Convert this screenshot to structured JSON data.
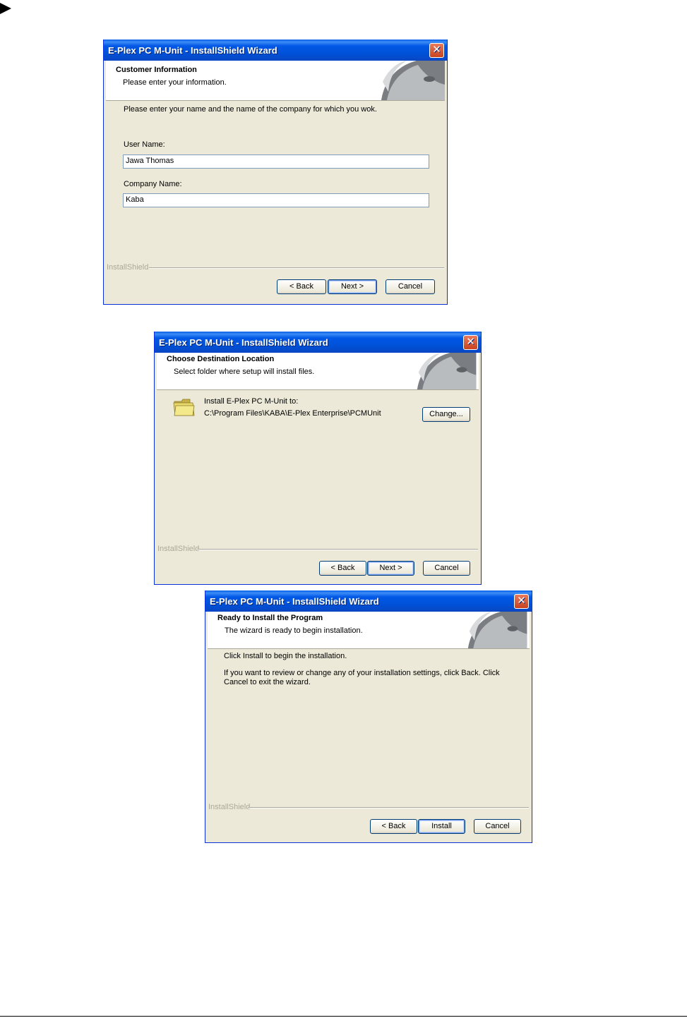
{
  "dialogs": [
    {
      "title": "E-Plex PC M-Unit - InstallShield Wizard",
      "close_label": "✕",
      "header_title": "Customer Information",
      "header_subtitle": "Please enter your information.",
      "intro": "Please enter your name and the name of the company for which you wok.",
      "user_name_label": "User Name:",
      "user_name_value": "Jawa Thomas",
      "company_label": "Company Name:",
      "company_value": "Kaba",
      "brand": "InstallShield",
      "back_label": "< Back",
      "next_label": "Next >",
      "cancel_label": "Cancel"
    },
    {
      "title": "E-Plex PC M-Unit - InstallShield Wizard",
      "close_label": "✕",
      "header_title": "Choose Destination Location",
      "header_subtitle": "Select folder where setup will install files.",
      "install_to": "Install E-Plex PC M-Unit to:",
      "path": "C:\\Program Files\\KABA\\E-Plex Enterprise\\PCMUnit",
      "change_label": "Change...",
      "brand": "InstallShield",
      "back_label": "< Back",
      "next_label": "Next >",
      "cancel_label": "Cancel"
    },
    {
      "title": "E-Plex PC M-Unit - InstallShield Wizard",
      "close_label": "✕",
      "header_title": "Ready to Install the Program",
      "header_subtitle": "The wizard is ready to begin installation.",
      "line1": "Click Install to begin the installation.",
      "line2": "If you want to review or change any of your installation settings, click Back. Click Cancel to exit the wizard.",
      "brand": "InstallShield",
      "back_label": "< Back",
      "install_label": "Install",
      "cancel_label": "Cancel"
    }
  ]
}
